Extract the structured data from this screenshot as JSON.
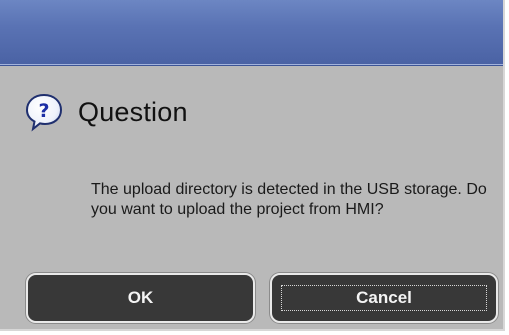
{
  "dialog": {
    "heading": "Question",
    "icon": "question-icon",
    "message": "The upload directory is detected in the USB storage. Do you want to upload the project from HMI?",
    "buttons": {
      "ok_label": "OK",
      "cancel_label": "Cancel"
    },
    "colors": {
      "titlebar": "#5a73b4",
      "body": "#b9b9b9",
      "button": "#383838"
    }
  }
}
